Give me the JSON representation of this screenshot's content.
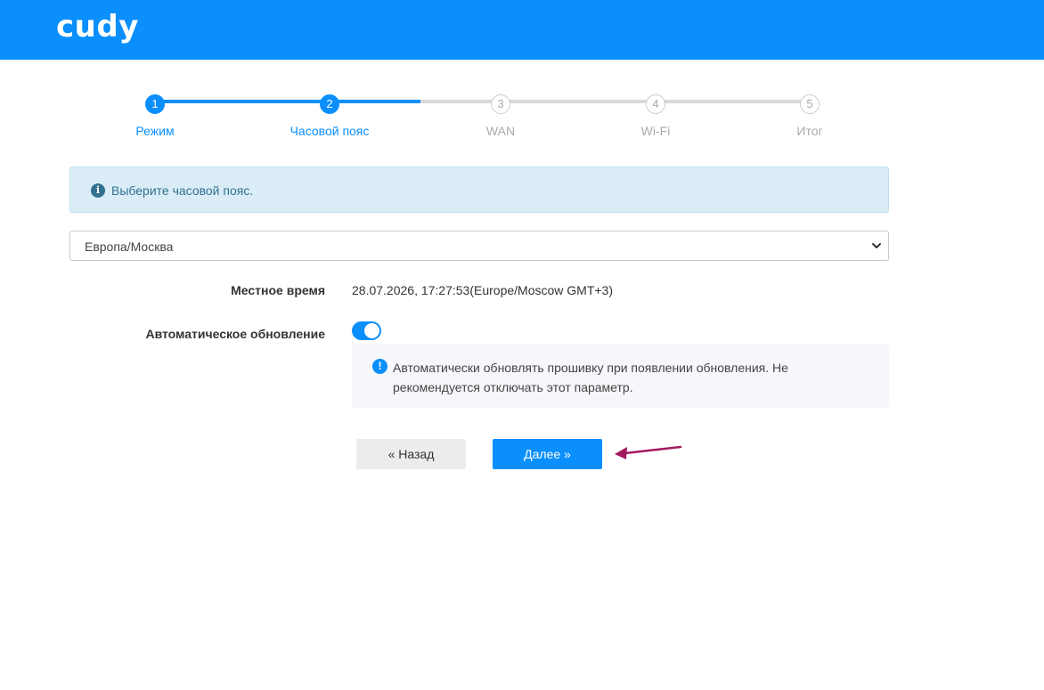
{
  "header": {
    "logo_text": "cudy",
    "background_color": "#0a8ffc"
  },
  "wizard": {
    "steps": [
      {
        "number": "1",
        "label": "Режим",
        "state": "done"
      },
      {
        "number": "2",
        "label": "Часовой пояс",
        "state": "current"
      },
      {
        "number": "3",
        "label": "WAN",
        "state": "todo"
      },
      {
        "number": "4",
        "label": "Wi-Fi",
        "state": "todo"
      },
      {
        "number": "5",
        "label": "Итог",
        "state": "todo"
      }
    ],
    "accent_color": "#0a8ffc",
    "inactive_color": "#cccccc"
  },
  "info": {
    "icon": "info-icon",
    "text": "Выберите часовой пояс."
  },
  "timezone": {
    "selected": "Европа/Москва"
  },
  "local_time": {
    "label": "Местное время",
    "value": "28.07.2026, 17:27:53(Europe/Moscow GMT+3)"
  },
  "auto_update": {
    "label": "Автоматическое обновление",
    "enabled": true,
    "note": "Автоматически обновлять прошивку при появлении обновления. Не рекомендуется отключать этот параметр."
  },
  "buttons": {
    "back_label": "« Назад",
    "next_label": "Далее »"
  },
  "annotation": {
    "arrow_color": "#a3185f"
  }
}
